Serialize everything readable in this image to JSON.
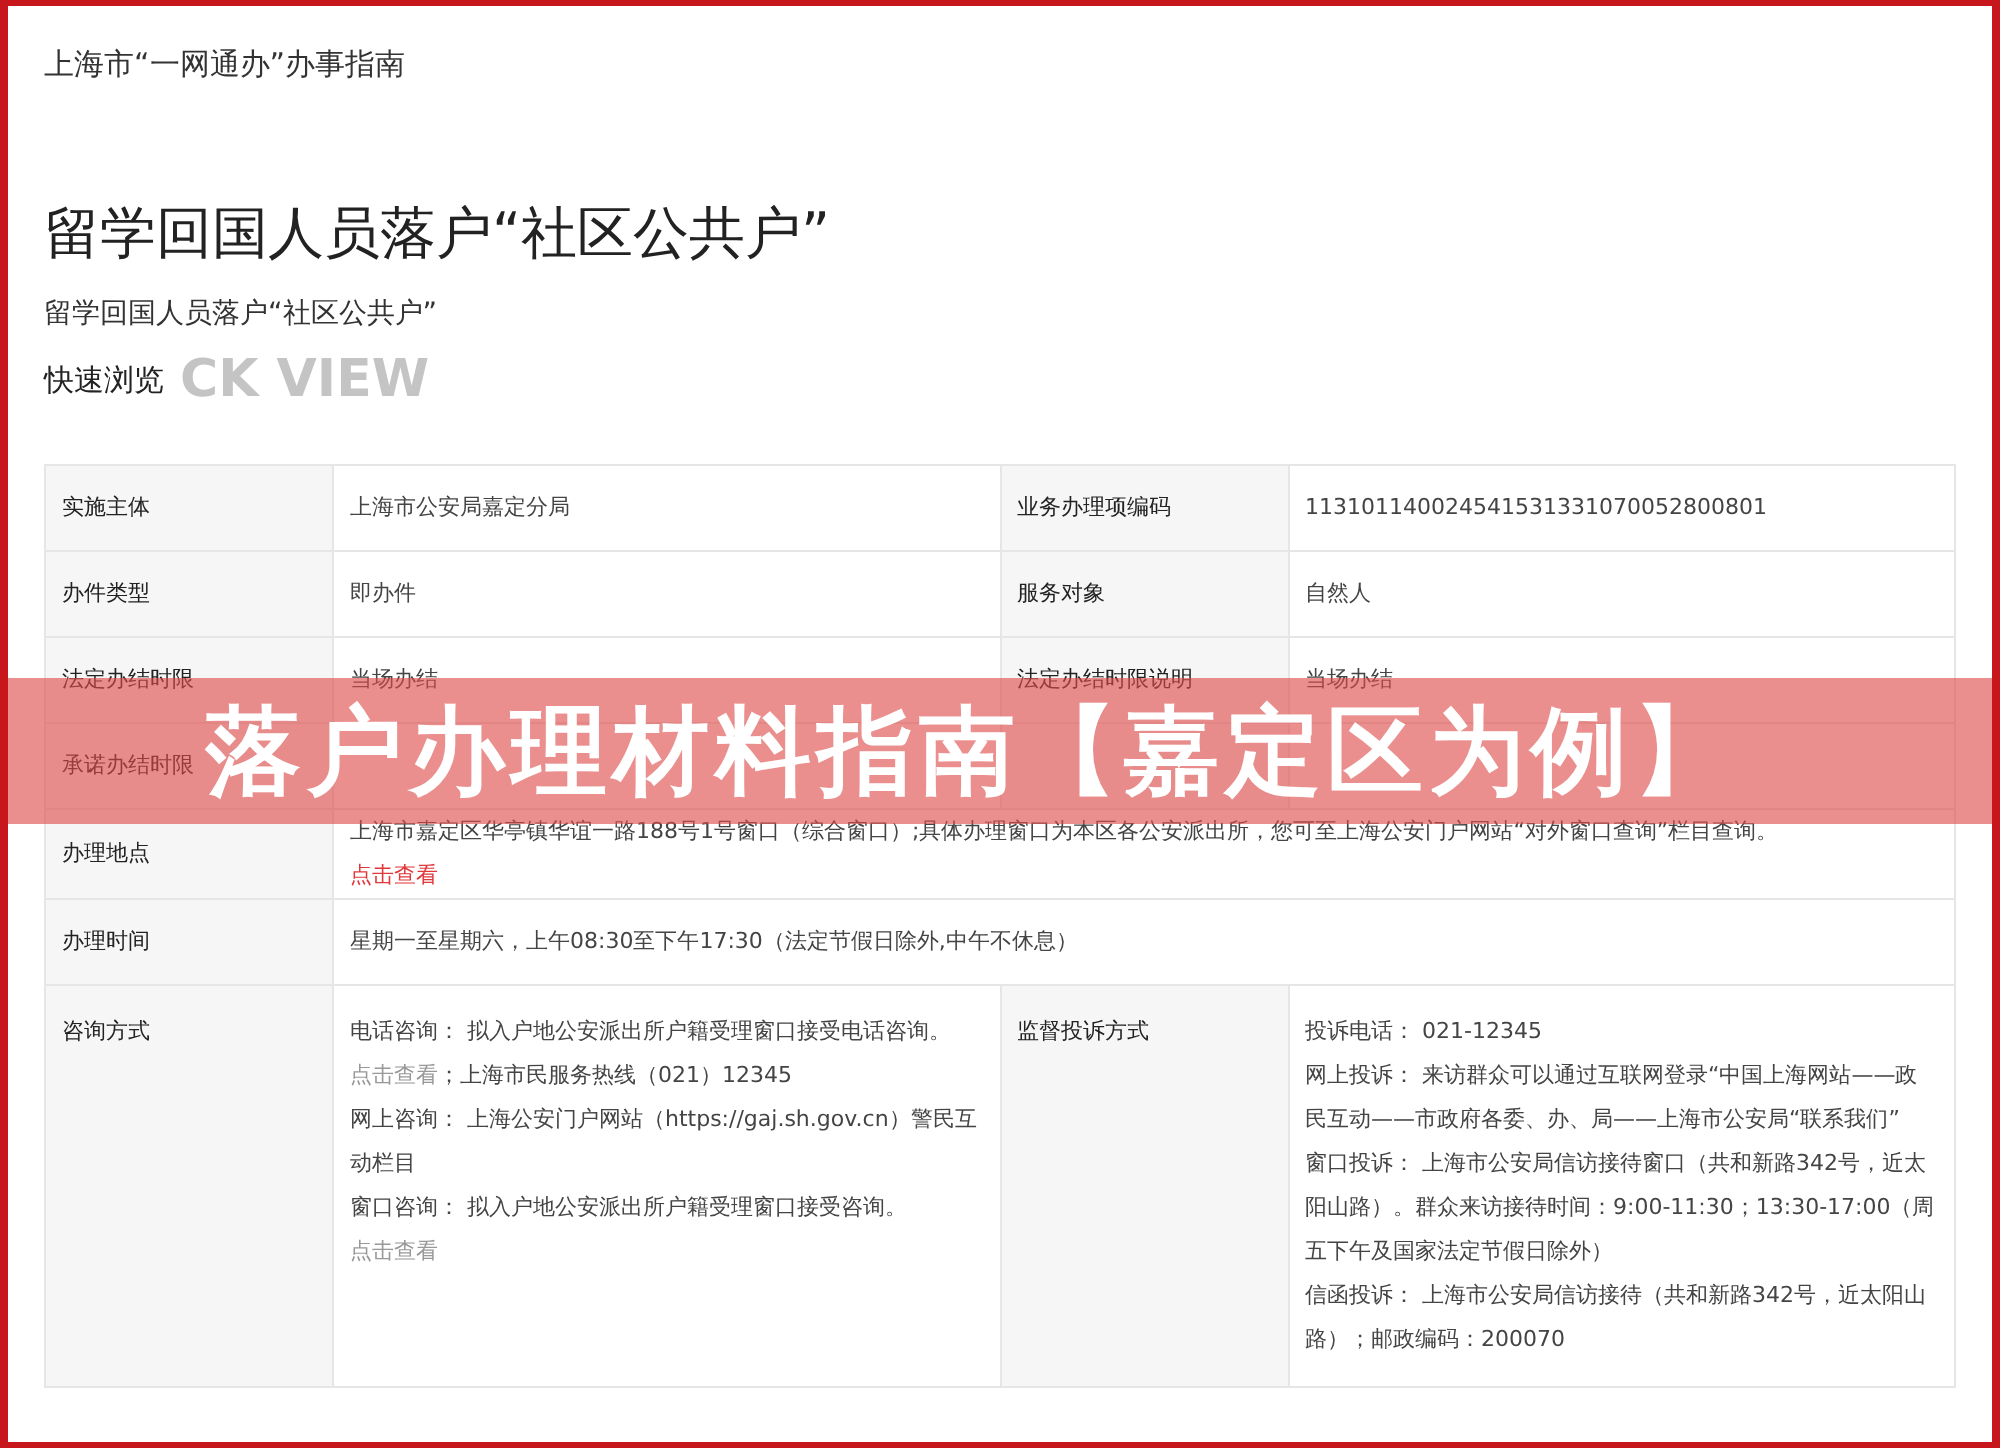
{
  "site_title": "上海市“一网通办”办事指南",
  "heading": "留学回国人员落户“社区公共户”",
  "subheading": "留学回国人员落户“社区公共户”",
  "section": {
    "title": "快速浏览",
    "backdrop": "CK VIEW"
  },
  "table": {
    "rows": [
      {
        "kind": "pair",
        "label": "实施主体",
        "value": [
          [
            {
              "kind": "plain",
              "text": "上海市公安局嘉定分局"
            }
          ]
        ],
        "label_2": "业务办理项编码",
        "value_2": [
          [
            {
              "kind": "plain",
              "text": "113101140024541531331070052800801"
            }
          ]
        ]
      },
      {
        "kind": "pair",
        "label": "办件类型",
        "value": [
          [
            {
              "kind": "plain",
              "text": "即办件"
            }
          ]
        ],
        "label_2": "服务对象",
        "value_2": [
          [
            {
              "kind": "plain",
              "text": "自然人"
            }
          ]
        ]
      },
      {
        "kind": "pair",
        "label": "法定办结时限",
        "value": [
          [
            {
              "kind": "plain",
              "text": "当场办结"
            }
          ]
        ],
        "label_2": "法定办结时限说明",
        "value_2": [
          [
            {
              "kind": "plain",
              "text": "当场办结"
            }
          ]
        ]
      },
      {
        "kind": "pair",
        "label": "承诺办结时限",
        "value": []
      },
      {
        "kind": "wide",
        "label": "办理地点",
        "value": [
          [
            {
              "kind": "plain",
              "text": "上海市嘉定区华亭镇华谊一路188号1号窗口（综合窗口）;具体办理窗口为本区各公安派出所，您可至上海公安门户网站“对外窗口查询”栏目查询。"
            }
          ],
          [
            {
              "kind": "link",
              "text": "点击查看"
            }
          ]
        ]
      },
      {
        "kind": "wide",
        "label": "办理时间",
        "value": [
          [
            {
              "kind": "plain",
              "text": "星期一至星期六，上午08:30至下午17:30（法定节假日除外,中午不休息）"
            }
          ]
        ]
      },
      {
        "kind": "pair",
        "label": "咨询方式",
        "value": [
          [
            {
              "kind": "plain",
              "text": "电话咨询： 拟入户地公安派出所户籍受理窗口接受电话咨询。"
            }
          ],
          [
            {
              "kind": "muted_link",
              "text": "点击查看"
            },
            {
              "kind": "plain",
              "text": "；上海市民服务热线（021）12345"
            }
          ],
          [
            {
              "kind": "plain",
              "text": "网上咨询： 上海公安门户网站（https://gaj.sh.gov.cn）警民互动栏目"
            }
          ],
          [
            {
              "kind": "plain",
              "text": "窗口咨询： 拟入户地公安派出所户籍受理窗口接受咨询。 "
            },
            {
              "kind": "muted_link",
              "text": "点击查看"
            }
          ]
        ],
        "label_2": "监督投诉方式",
        "value_2": [
          [
            {
              "kind": "plain",
              "text": "投诉电话： 021-12345"
            }
          ],
          [
            {
              "kind": "plain",
              "text": "网上投诉： 来访群众可以通过互联网登录“中国上海网站——政民互动——市政府各委、办、局——上海市公安局“联系我们”"
            }
          ],
          [
            {
              "kind": "plain",
              "text": "窗口投诉： 上海市公安局信访接待窗口（共和新路342号，近太阳山路）。群众来访接待时间：9:00-11:30；13:30-17:00（周五下午及国家法定节假日除外）"
            }
          ],
          [
            {
              "kind": "plain",
              "text": "信函投诉： 上海市公安局信访接待（共和新路342号，近太阳山路）；邮政编码：200070"
            }
          ]
        ]
      }
    ]
  },
  "banner": {
    "text": "落户办理材料指南【嘉定区为例】"
  }
}
